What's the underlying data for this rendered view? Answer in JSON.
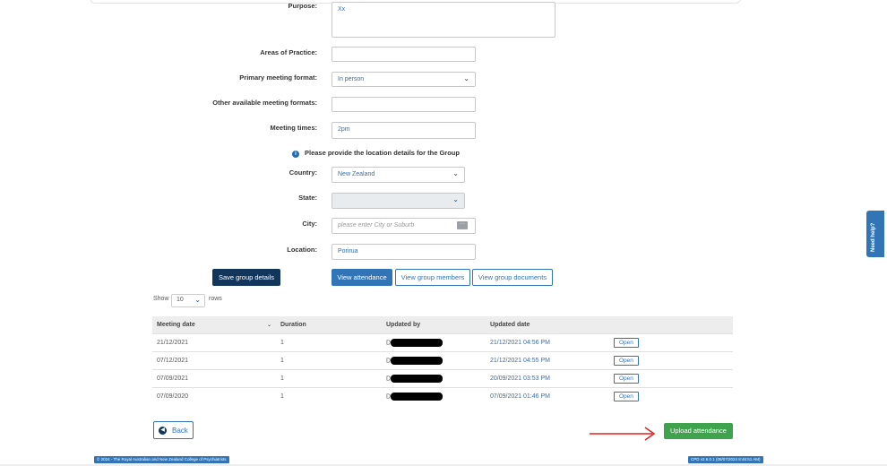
{
  "form": {
    "purpose": {
      "label": "Purpose:",
      "value": "Xx"
    },
    "areas_of_practice": {
      "label": "Areas of Practice:",
      "value": ""
    },
    "primary_meeting_format": {
      "label": "Primary meeting format:",
      "value": "In person"
    },
    "other_meeting_formats": {
      "label": "Other available meeting formats:",
      "value": ""
    },
    "meeting_times": {
      "label": "Meeting times:",
      "value": "2pm"
    },
    "location_info": "Please provide the location details for the Group",
    "country": {
      "label": "Country:",
      "value": "New Zealand"
    },
    "state": {
      "label": "State:",
      "value": ""
    },
    "city": {
      "label": "City:",
      "placeholder": "please enter City or Suburb"
    },
    "location": {
      "label": "Location:",
      "value": "Porirua"
    }
  },
  "buttons": {
    "save_group_details": "Save group details",
    "view_attendance": "View attendance",
    "view_group_members": "View group members",
    "view_group_documents": "View group documents",
    "back": "Back",
    "upload_attendance": "Upload attendance"
  },
  "table_controls": {
    "show": "Show",
    "page_size": "10",
    "rows": "rows"
  },
  "table": {
    "headers": [
      "Meeting date",
      "Duration",
      "Updated by",
      "Updated date",
      ""
    ],
    "rows": [
      {
        "meeting_date": "21/12/2021",
        "duration": "1",
        "updated_by": "Dr",
        "updated_date": "21/12/2021 04:56 PM",
        "action": "Open"
      },
      {
        "meeting_date": "07/12/2021",
        "duration": "1",
        "updated_by": "Dr",
        "updated_date": "21/12/2021 04:55 PM",
        "action": "Open"
      },
      {
        "meeting_date": "07/09/2021",
        "duration": "1",
        "updated_by": "Dr",
        "updated_date": "20/09/2021 03:53 PM",
        "action": "Open"
      },
      {
        "meeting_date": "07/09/2020",
        "duration": "1",
        "updated_by": "Dr",
        "updated_date": "07/09/2021 01:46 PM",
        "action": "Open"
      }
    ]
  },
  "footer": {
    "copyright": "© 2024 - The Royal Australian and New Zealand College of Psychiatrists",
    "version": "CPD v2.6.0.1 (08/07/2024 8:46:51 AM)"
  },
  "need_help": "Need help?",
  "colors": {
    "primary": "#3175b7",
    "dark": "#12355b",
    "success": "#3fa34d",
    "annotation_arrow": "#e02020"
  }
}
